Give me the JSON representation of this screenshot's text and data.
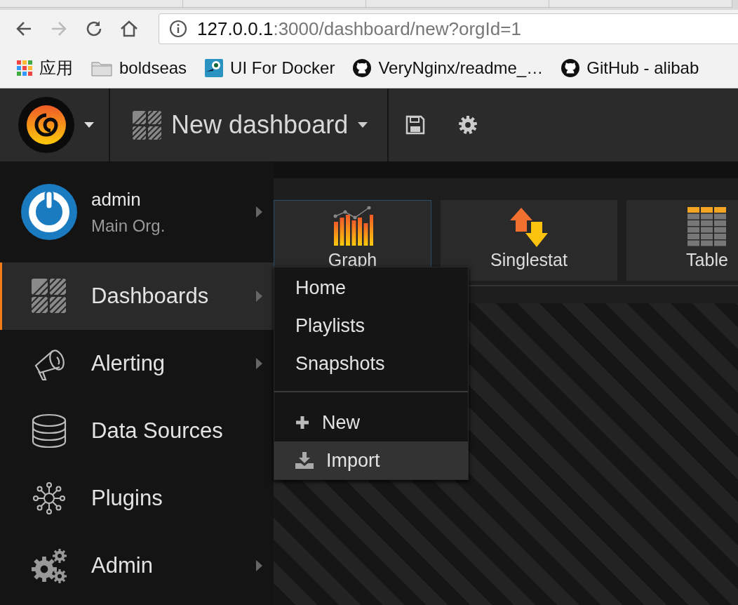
{
  "browser": {
    "address": {
      "host": "127.0.0.1",
      "path": ":3000/dashboard/new?orgId=1"
    },
    "bookmarks": [
      {
        "label": "应用",
        "kind": "apps"
      },
      {
        "label": "boldseas",
        "kind": "folder"
      },
      {
        "label": "UI For Docker",
        "kind": "tile"
      },
      {
        "label": "VeryNginx/readme_…",
        "kind": "github"
      },
      {
        "label": "GitHub - alibab",
        "kind": "github"
      }
    ]
  },
  "navbar": {
    "dashboard_title": "New dashboard"
  },
  "sidebar": {
    "user": {
      "name": "admin",
      "org": "Main Org."
    },
    "items": [
      {
        "label": "Dashboards",
        "kind": "dashboards",
        "selected": true,
        "submenu": true
      },
      {
        "label": "Alerting",
        "kind": "alerting",
        "selected": false,
        "submenu": true
      },
      {
        "label": "Data Sources",
        "kind": "datasources",
        "selected": false,
        "submenu": false
      },
      {
        "label": "Plugins",
        "kind": "plugins",
        "selected": false,
        "submenu": false
      },
      {
        "label": "Admin",
        "kind": "admin",
        "selected": false,
        "submenu": true
      }
    ]
  },
  "panels": [
    {
      "label": "Graph",
      "kind": "graph",
      "selected": true
    },
    {
      "label": "Singlestat",
      "kind": "singlestat",
      "selected": false
    },
    {
      "label": "Table",
      "kind": "table",
      "selected": false
    }
  ],
  "submenu": {
    "links": [
      {
        "label": "Home",
        "selected": false
      },
      {
        "label": "Playlists",
        "selected": false
      },
      {
        "label": "Snapshots",
        "selected": false
      }
    ],
    "actions": [
      {
        "label": "New",
        "kind": "new",
        "selected": false
      },
      {
        "label": "Import",
        "kind": "import",
        "selected": true
      }
    ]
  }
}
